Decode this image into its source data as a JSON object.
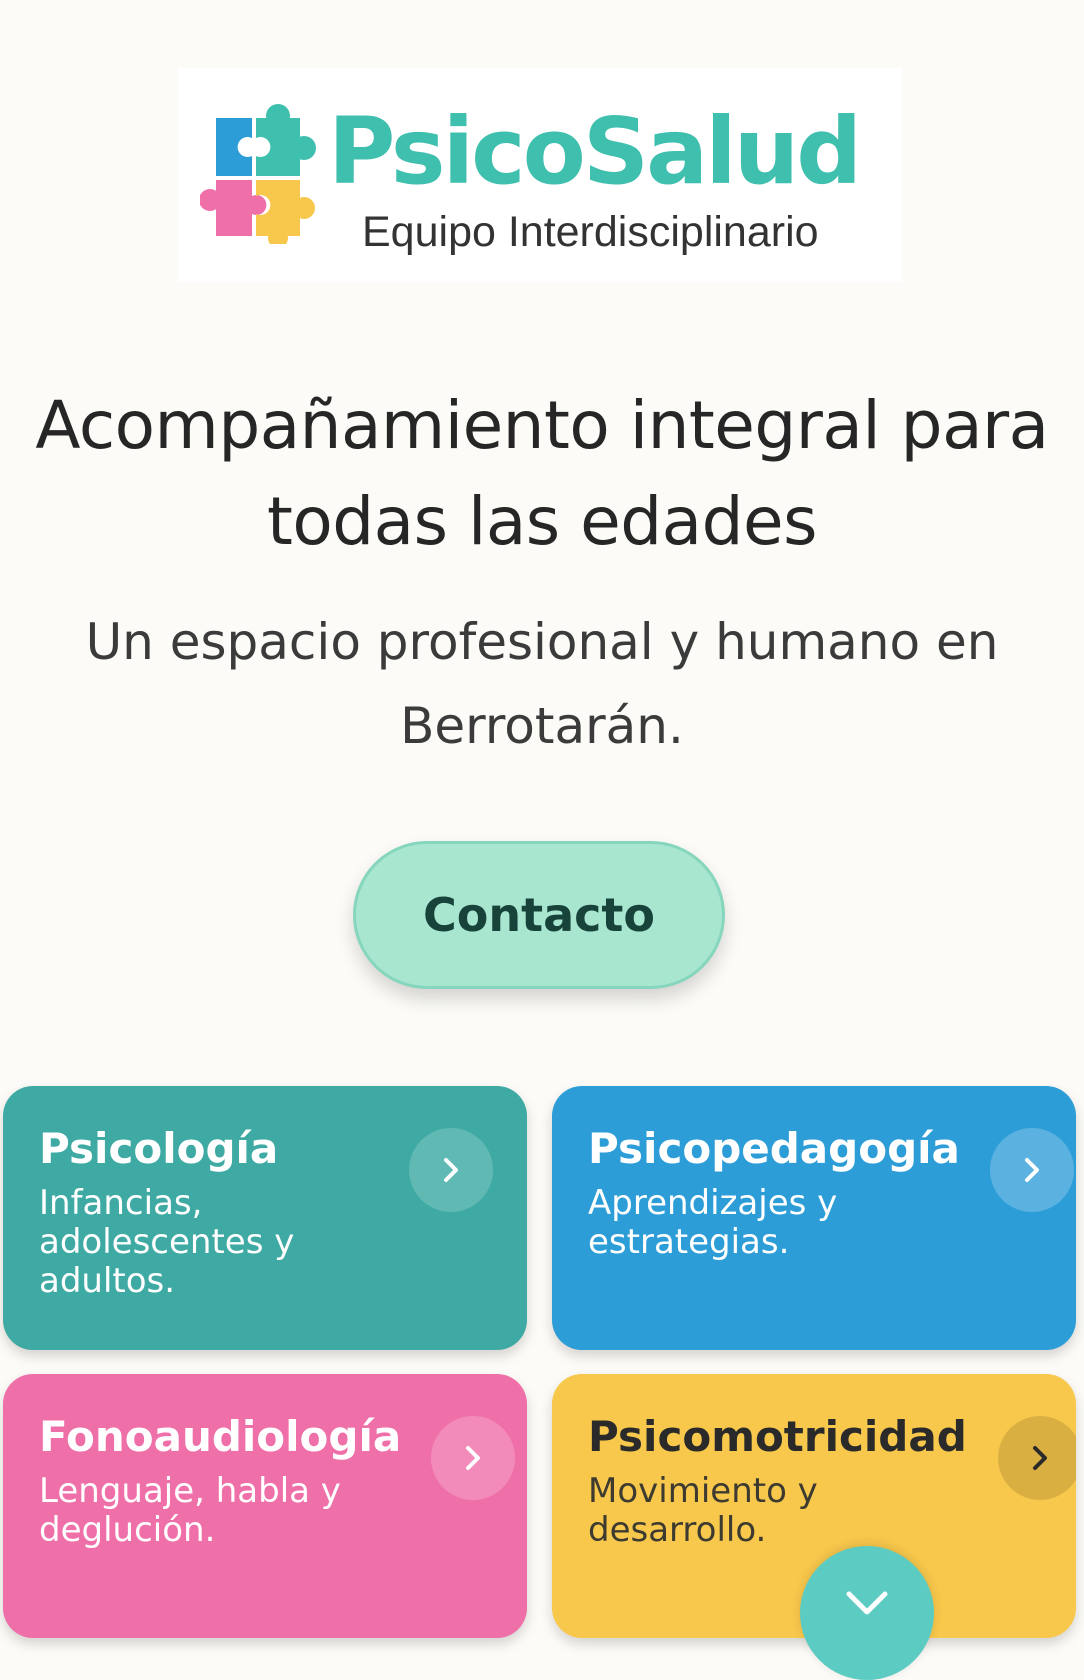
{
  "logo": {
    "name": "PsicoSalud",
    "tagline": "Equipo Interdisciplinario",
    "puzzle_colors": [
      "#2d9dd8",
      "#3fbfae",
      "#ef6fa9",
      "#f8c84c"
    ]
  },
  "hero": {
    "title": "Acompañamiento integral para todas las edades",
    "subtitle": "Un espacio profesional y humano en Berrotarán."
  },
  "cta": {
    "label": "Contacto"
  },
  "services": [
    {
      "title": "Psicología",
      "description": "Infancias, adolescentes y adultos.",
      "color": "#3eaaa3",
      "icon": "chevron-right-icon"
    },
    {
      "title": "Psicopedagogía",
      "description": "Aprendizajes y estrategias.",
      "color": "#2d9dd8",
      "icon": "chevron-right-icon"
    },
    {
      "title": "Fonoaudiología",
      "description": "Lenguaje, habla y deglución.",
      "color": "#ef6fa9",
      "icon": "chevron-right-icon"
    },
    {
      "title": "Psicomotricidad",
      "description": "Movimiento y desarrollo.",
      "color": "#f8c84c",
      "icon": "chevron-right-icon"
    }
  ],
  "scroll_button": {
    "icon": "chevron-down-icon",
    "color": "#5ccbc2"
  }
}
